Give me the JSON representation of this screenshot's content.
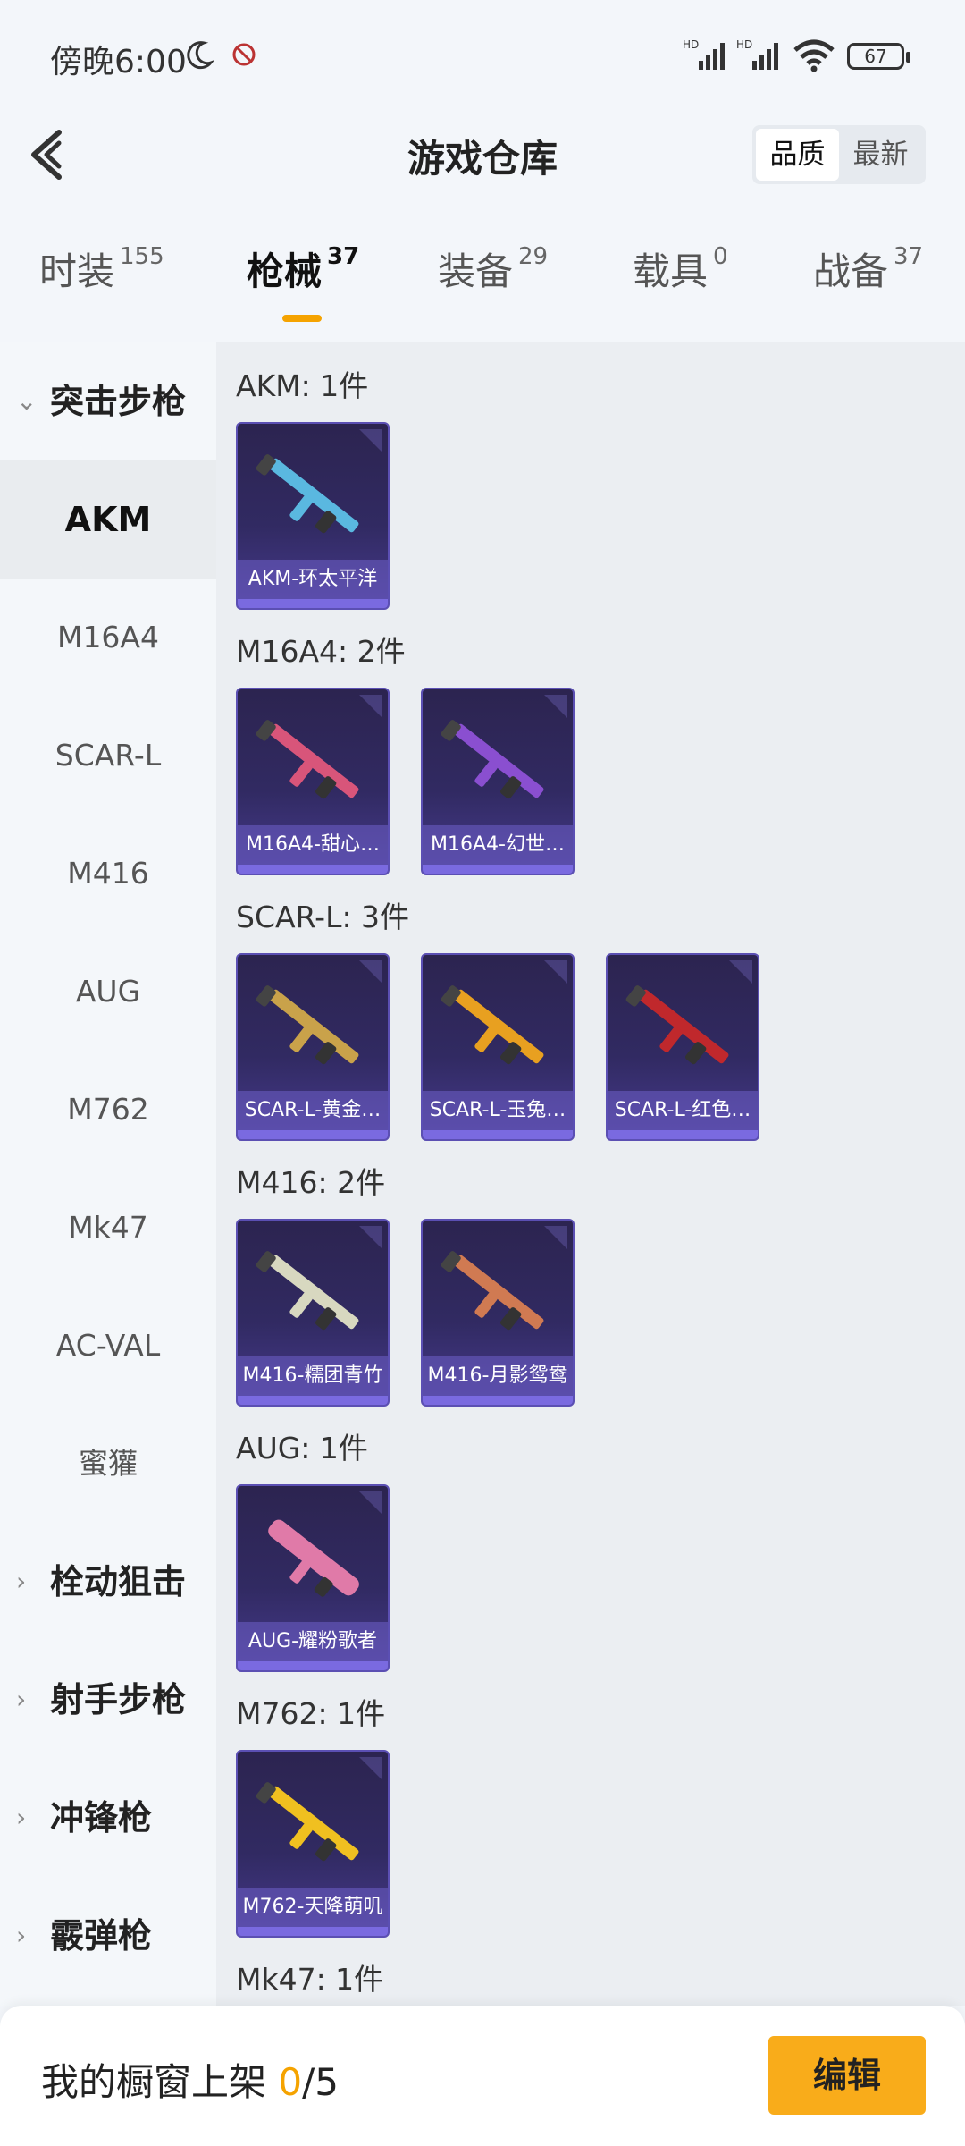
{
  "status_bar": {
    "time": "傍晚6:00",
    "battery": "67",
    "moon_icon": "moon-icon",
    "signal_icon": "signal-icon",
    "wifi_icon": "wifi-icon"
  },
  "header": {
    "title": "游戏仓库",
    "sort_options": [
      "品质",
      "最新"
    ],
    "sort_selected": "品质"
  },
  "tabs": [
    {
      "label": "时装",
      "count": "155"
    },
    {
      "label": "枪械",
      "count": "37"
    },
    {
      "label": "装备",
      "count": "29"
    },
    {
      "label": "载具",
      "count": "0"
    },
    {
      "label": "战备",
      "count": "37"
    }
  ],
  "active_tab": "枪械",
  "sidebar": {
    "expanded_category": "突击步枪",
    "sub_items": [
      "AKM",
      "M16A4",
      "SCAR-L",
      "M416",
      "AUG",
      "M762",
      "Mk47",
      "AC-VAL",
      "蜜獾"
    ],
    "active_sub": "AKM",
    "collapsed_categories": [
      "栓动狙击",
      "射手步枪",
      "冲锋枪",
      "霰弹枪"
    ]
  },
  "groups": [
    {
      "label": "AKM: 1件",
      "items": [
        {
          "name": "AKM-环太平洋",
          "color": "#5ab8e0"
        }
      ]
    },
    {
      "label": "M16A4: 2件",
      "items": [
        {
          "name": "M16A4-甜心…",
          "color": "#d8557a"
        },
        {
          "name": "M16A4-幻世…",
          "color": "#8a4fd0"
        }
      ]
    },
    {
      "label": "SCAR-L: 3件",
      "items": [
        {
          "name": "SCAR-L-黄金…",
          "color": "#c9a24a"
        },
        {
          "name": "SCAR-L-玉兔…",
          "color": "#e8a020"
        },
        {
          "name": "SCAR-L-红色…",
          "color": "#c0282c"
        }
      ]
    },
    {
      "label": "M416: 2件",
      "items": [
        {
          "name": "M416-糯团青竹",
          "color": "#d8d8c0"
        },
        {
          "name": "M416-月影鸳鸯",
          "color": "#d07a52"
        }
      ]
    },
    {
      "label": "AUG: 1件",
      "items": [
        {
          "name": "AUG-耀粉歌者",
          "color": "#e07aa8"
        }
      ]
    },
    {
      "label": "M762: 1件",
      "items": [
        {
          "name": "M762-天降萌叽",
          "color": "#f0c020"
        }
      ]
    },
    {
      "label": "Mk47: 1件",
      "items": []
    }
  ],
  "footer": {
    "text": "我的橱窗上架",
    "shown": "0",
    "total": "/5",
    "edit_label": "编辑"
  }
}
